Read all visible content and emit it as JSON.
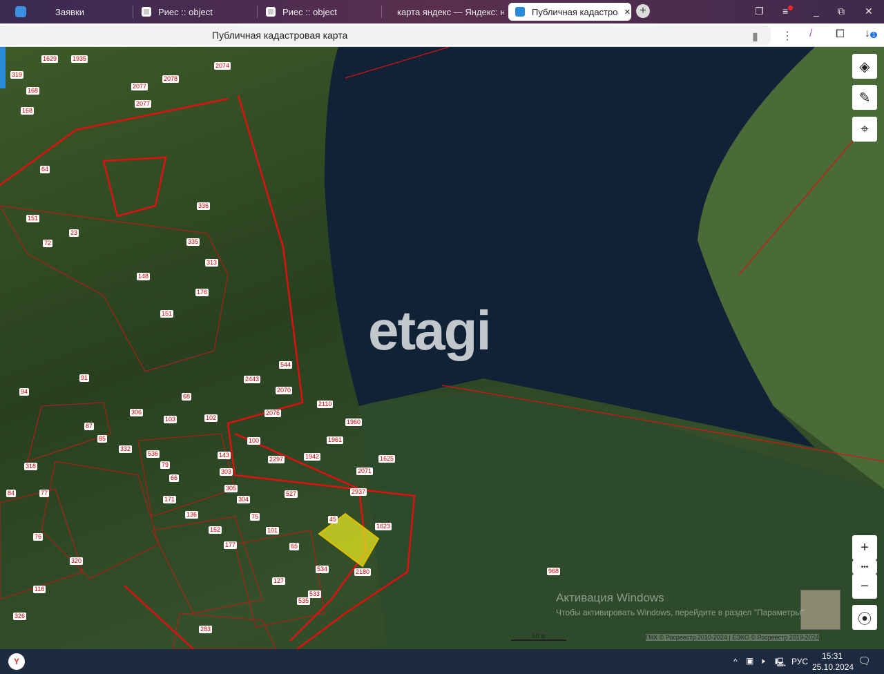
{
  "browser": {
    "tabs": [
      {
        "label": "Заявки",
        "color": "#3d8fe0"
      },
      {
        "label": "Риес :: object",
        "color": "#c0392b"
      },
      {
        "label": "Риес :: object",
        "color": "#c0392b"
      },
      {
        "label": "карта яндекс — Яндекс: н",
        "color": "#e53935"
      },
      {
        "label": "Публичная кадастрова",
        "color": "#2a8ad8"
      }
    ],
    "close": "×",
    "new_tab": "+",
    "downloads_badge": "1"
  },
  "address": {
    "title": "Публичная кадастровая карта"
  },
  "map": {
    "watermark": "etagi",
    "parcels": [
      "2077",
      "2078",
      "2074",
      "2077",
      "336",
      "335",
      "313",
      "148",
      "176",
      "151",
      "544",
      "2443",
      "2070",
      "91",
      "68",
      "102",
      "103",
      "87",
      "85",
      "2076",
      "2110",
      "1960",
      "1961",
      "100",
      "1942",
      "1625",
      "2071",
      "2937",
      "527",
      "45",
      "1623",
      "968",
      "534",
      "533",
      "535",
      "127",
      "283",
      "116",
      "326",
      "136",
      "152",
      "171",
      "66",
      "79",
      "536",
      "143",
      "303",
      "305",
      "304",
      "75",
      "101",
      "65",
      "177",
      "320",
      "76",
      "77",
      "84",
      "318",
      "94",
      "1629",
      "1935",
      "168",
      "168",
      "319",
      "64",
      "72",
      "23",
      "151",
      "2180",
      "2297",
      "332",
      "306"
    ],
    "scale": "60 м",
    "attribution": "ПКК © Росреестр 2010-2024 | ЕЭКО © Росреестр 2019-2024",
    "activation_line1": "Активация Windows",
    "activation_line2": "Чтобы активировать Windows, перейдите в раздел \"Параметры\"",
    "controls": {
      "zoom_in": "+",
      "more": "•••",
      "zoom_out": "−"
    }
  },
  "taskbar": {
    "lang": "РУС",
    "time": "15:31",
    "date": "25.10.2024"
  }
}
